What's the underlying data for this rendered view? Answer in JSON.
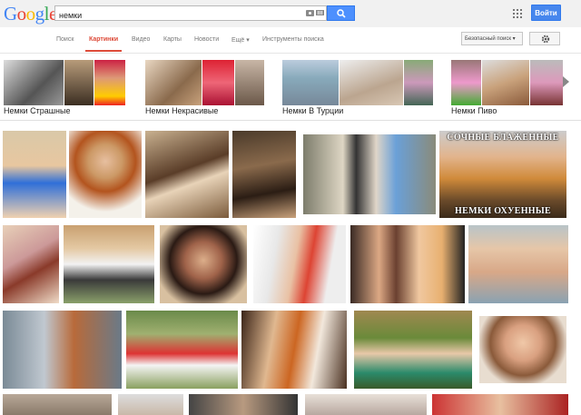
{
  "header": {
    "logo": "Google",
    "search_value": "немки",
    "signin_label": "Войти"
  },
  "nav": {
    "items": [
      "Поиск",
      "Картинки",
      "Видео",
      "Карты",
      "Новости",
      "Ещё ▾",
      "Инструменты поиска"
    ],
    "active": "Картинки",
    "safesearch": "Безопасный поиск ▾"
  },
  "related": [
    {
      "label": "Немки Страшные"
    },
    {
      "label": "Немки Некрасивые"
    },
    {
      "label": "Немки В Турции"
    },
    {
      "label": "Немки Пиво"
    }
  ],
  "overlays": {
    "top": "СОЧНЫЕ БЛАЖЕННЫЕ",
    "bottom": "НЕМКИ ОХУЕННЫЕ"
  },
  "colors": {
    "accent": "#dd4b39",
    "search_blue": "#4d90fe"
  }
}
